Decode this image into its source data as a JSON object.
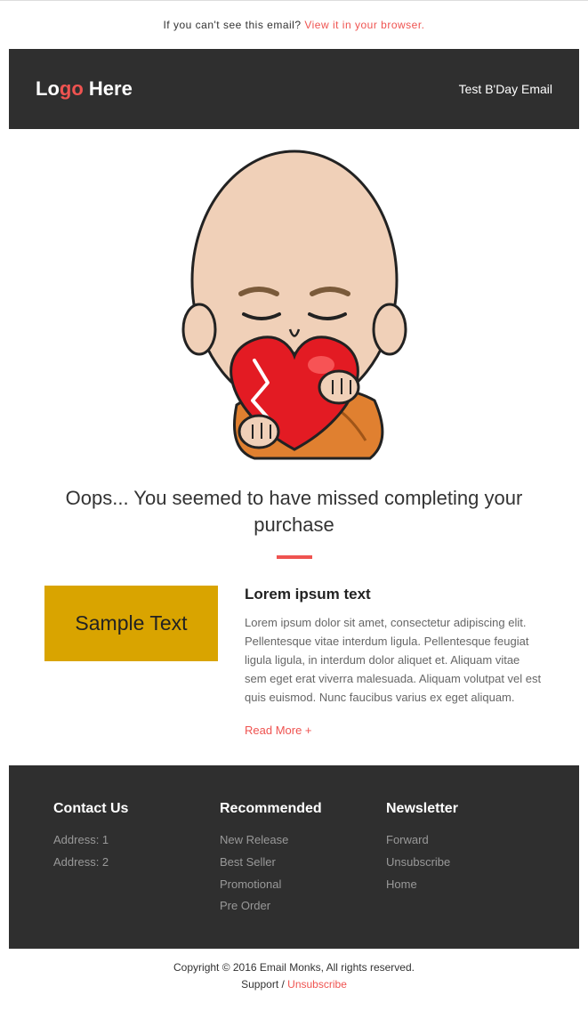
{
  "preheader": {
    "text": "If you can't see this email? ",
    "link": "View it in your browser."
  },
  "header": {
    "logo_part1": "Lo",
    "logo_accent": "go",
    "logo_part2": " Here",
    "right_text": "Test B'Day Email"
  },
  "main": {
    "headline": "Oops... You seemed to have missed completing your purchase",
    "sample_text": "Sample Text",
    "article_title": "Lorem ipsum text",
    "article_body": "Lorem ipsum dolor sit amet, consectetur adipiscing elit. Pellentesque vitae interdum ligula. Pellentesque feugiat ligula ligula, in interdum dolor aliquet et. Aliquam vitae sem eget erat viverra malesuada. Aliquam volutpat vel est quis euismod. Nunc faucibus varius ex eget aliquam.",
    "readmore": "Read More +"
  },
  "footer": {
    "col1": {
      "title": "Contact Us",
      "items": [
        "Address: 1",
        "Address: 2"
      ]
    },
    "col2": {
      "title": "Recommended",
      "items": [
        "New Release",
        "Best Seller",
        "Promotional",
        "Pre Order"
      ]
    },
    "col3": {
      "title": "Newsletter",
      "items": [
        "Forward",
        "Unsubscribe",
        "Home"
      ]
    }
  },
  "bottom": {
    "copyright": "Copyright © 2016 Email Monks, All rights reserved.",
    "support": "Support",
    "separator": " / ",
    "unsubscribe": "Unsubscribe"
  }
}
